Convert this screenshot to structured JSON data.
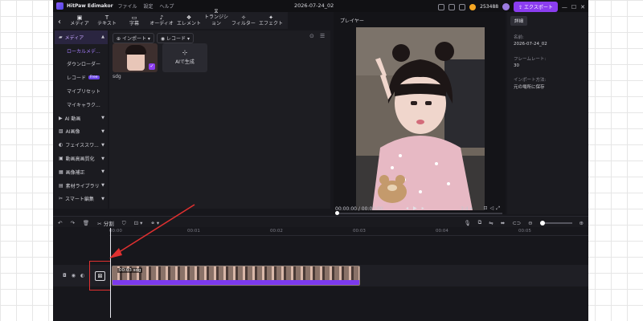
{
  "app": {
    "name": "HitPaw Edimakor",
    "menus": [
      "ファイル",
      "設定",
      "ヘルプ"
    ],
    "document_title": "2026-07-24_02",
    "credits": "253488",
    "export_label": "エクスポート",
    "window_controls": [
      "—",
      "☐",
      "✕"
    ]
  },
  "toolbar": {
    "back": "‹",
    "tools": [
      {
        "label": "メディア",
        "icon": "media-icon"
      },
      {
        "label": "テキスト",
        "icon": "text-icon"
      },
      {
        "label": "字幕",
        "icon": "subtitle-icon"
      },
      {
        "label": "オーディオ",
        "icon": "audio-icon"
      },
      {
        "label": "エレメント",
        "icon": "element-icon"
      },
      {
        "label": "トランジション",
        "icon": "transition-icon"
      },
      {
        "label": "フィルター",
        "icon": "filter-icon"
      },
      {
        "label": "エフェクト",
        "icon": "effect-icon"
      }
    ]
  },
  "sidebar": {
    "items": [
      {
        "label": "メディア",
        "type": "section",
        "active": true
      },
      {
        "label": "ローカルメデ...",
        "type": "sub",
        "selected": true
      },
      {
        "label": "ダウンローダー",
        "type": "sub"
      },
      {
        "label": "レコード",
        "type": "sub",
        "badge": "Free"
      },
      {
        "label": "マイプリセット",
        "type": "sub"
      },
      {
        "label": "マイキャラク...",
        "type": "sub"
      },
      {
        "label": "AI 動画",
        "type": "section"
      },
      {
        "label": "AI画像",
        "type": "section"
      },
      {
        "label": "フェイススワ...",
        "type": "section"
      },
      {
        "label": "動画高画質化",
        "type": "section"
      },
      {
        "label": "画像補正",
        "type": "section"
      },
      {
        "label": "素材ライブラリ",
        "type": "section"
      },
      {
        "label": "スマート編集",
        "type": "section"
      }
    ]
  },
  "media_panel": {
    "import_label": "インポート",
    "record_label": "レコード",
    "item_name": "sdg",
    "ai_generate_label": "AIで生成"
  },
  "player": {
    "title": "プレイヤー",
    "current_time": "00:00:00",
    "total_time": "00:03:00",
    "ratio": "3:4"
  },
  "details": {
    "tab": "詳細",
    "fields": [
      {
        "label": "名前:",
        "value": "2026-07-24_02"
      },
      {
        "label": "フレームレート:",
        "value": "30"
      },
      {
        "label": "インポート方法:",
        "value": "元の場所に保存"
      }
    ]
  },
  "timeline": {
    "split_label": "分割",
    "ticks": [
      "00:00",
      "00:01",
      "00:02",
      "00:03",
      "00:04",
      "00:05"
    ],
    "clip_label": "00:03 sdg"
  },
  "colors": {
    "accent": "#8b3df0",
    "highlight": "#e03030",
    "panel": "#17171c"
  }
}
